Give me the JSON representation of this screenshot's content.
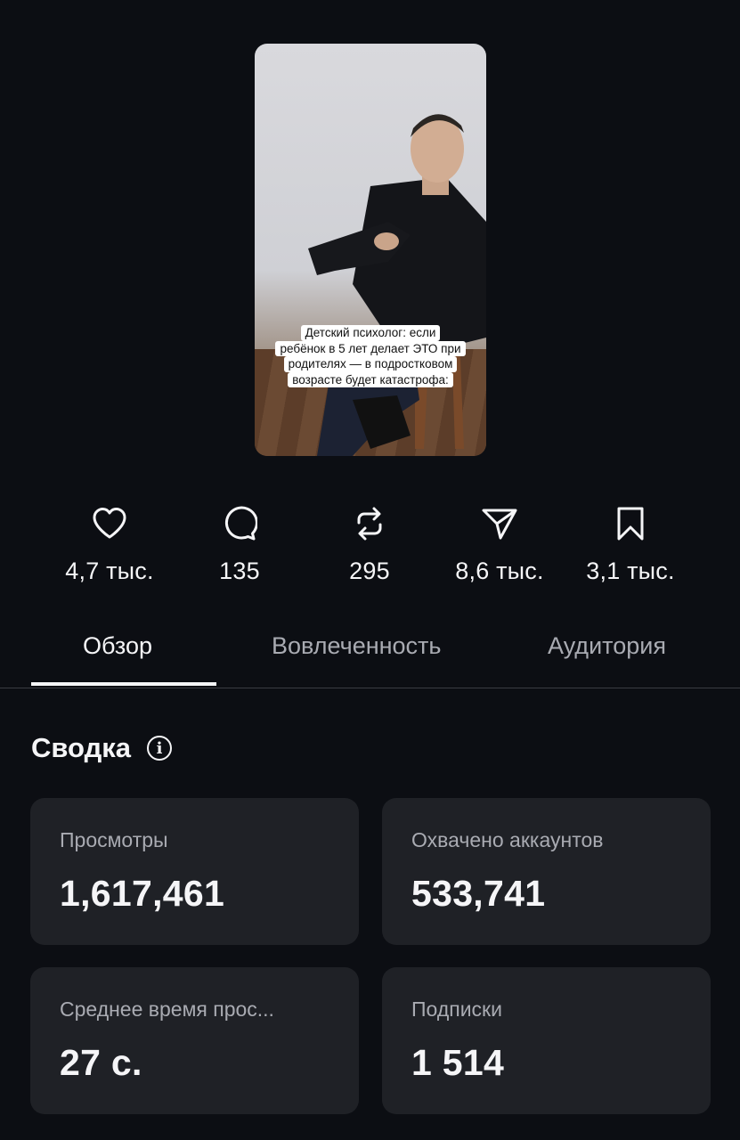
{
  "post": {
    "thumbnail_caption": [
      "Детский психолог: если",
      "ребёнок в 5 лет делает ЭТО при",
      "родителях — в подростковом",
      "возрасте будет катастрофа:"
    ]
  },
  "stats": {
    "likes": "4,7 тыс.",
    "comments": "135",
    "reposts": "295",
    "shares": "8,6 тыс.",
    "saves": "3,1 тыс."
  },
  "tabs": [
    {
      "label": "Обзор",
      "active": true
    },
    {
      "label": "Вовлеченность",
      "active": false
    },
    {
      "label": "Аудитория",
      "active": false
    }
  ],
  "summary": {
    "title": "Сводка",
    "cards": [
      {
        "label": "Просмотры",
        "value": "1,617,461"
      },
      {
        "label": "Охвачено аккаунтов",
        "value": "533,741"
      },
      {
        "label": "Среднее время прос...",
        "value": "27 с."
      },
      {
        "label": "Подписки",
        "value": "1 514"
      }
    ]
  },
  "colors": {
    "background": "#0c0e13",
    "card": "#1f2126",
    "text": "#f5f5f7",
    "muted": "#a9abb2"
  }
}
